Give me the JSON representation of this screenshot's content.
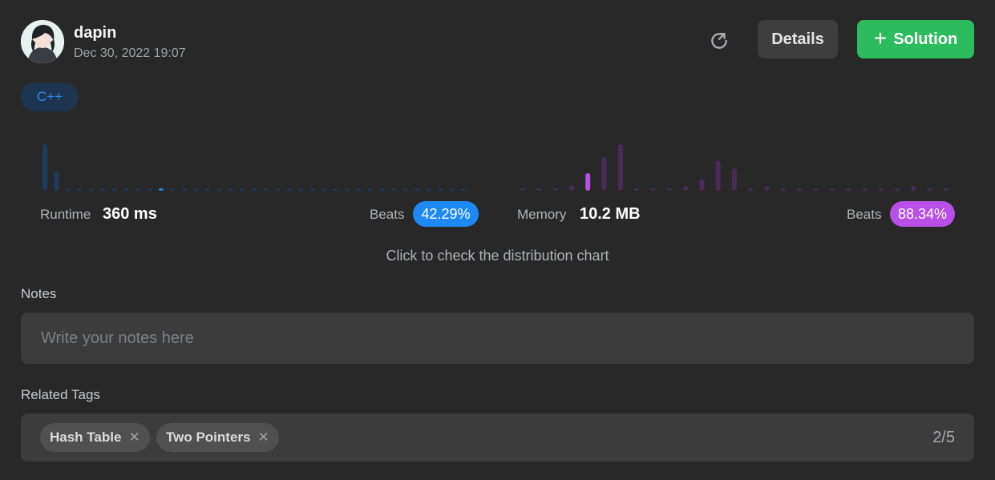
{
  "user": {
    "name": "dapin",
    "date": "Dec 30, 2022 19:07"
  },
  "header": {
    "details_label": "Details",
    "solution_label": "Solution"
  },
  "language": "C++",
  "runtime": {
    "label": "Runtime",
    "value": "360 ms",
    "beats_label": "Beats",
    "beats_value": "42.29%"
  },
  "memory": {
    "label": "Memory",
    "value": "10.2 MB",
    "beats_label": "Beats",
    "beats_value": "88.34%"
  },
  "distribution_link": "Click to check the distribution chart",
  "notes": {
    "label": "Notes",
    "placeholder": "Write your notes here"
  },
  "tags": {
    "label": "Related Tags",
    "items": [
      "Hash Table",
      "Two Pointers"
    ],
    "count": "2/5"
  },
  "colors": {
    "runtime": "#1e88f5",
    "memory": "#b84fe6",
    "success": "#2cbb5d"
  },
  "chart_data": [
    {
      "type": "bar",
      "name": "runtime-distribution",
      "values": [
        1.0,
        0.42,
        0.05,
        0.05,
        0.05,
        0.05,
        0.05,
        0.05,
        0.05,
        0.05,
        0.05,
        0.05,
        0.05,
        0.05,
        0.05,
        0.05,
        0.05,
        0.05,
        0.05,
        0.05,
        0.05,
        0.05,
        0.05,
        0.05,
        0.05,
        0.05,
        0.05,
        0.05,
        0.05,
        0.05,
        0.05,
        0.05,
        0.05,
        0.05,
        0.05,
        0.05,
        0.05
      ],
      "highlight_index": 10,
      "ylim": [
        0,
        1
      ]
    },
    {
      "type": "bar",
      "name": "memory-distribution",
      "values": [
        0.05,
        0.05,
        0.05,
        0.12,
        0.38,
        0.72,
        1.0,
        0.05,
        0.05,
        0.05,
        0.1,
        0.25,
        0.65,
        0.48,
        0.05,
        0.1,
        0.05,
        0.05,
        0.05,
        0.05,
        0.05,
        0.05,
        0.05,
        0.05,
        0.1,
        0.05,
        0.05
      ],
      "highlight_index": 4,
      "ylim": [
        0,
        1
      ]
    }
  ]
}
